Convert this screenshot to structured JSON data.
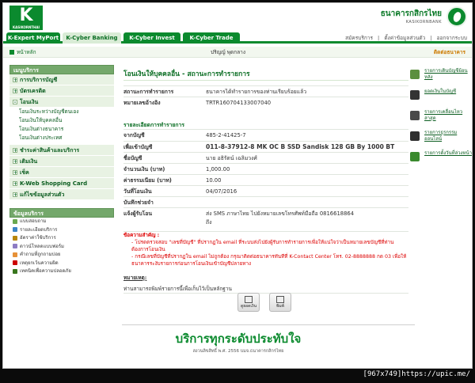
{
  "header": {
    "logo_text": "K",
    "logo_sub": "KASIKORNTHAI",
    "bank_name_th": "ธนาคารกสิกรไทย",
    "bank_name_en": "KASIKORNBANK"
  },
  "tabs": [
    {
      "label": "K-Expert MyPort"
    },
    {
      "label": "K-Cyber Banking"
    },
    {
      "label": "K-Cyber Invest"
    },
    {
      "label": "K-Cyber Trade"
    }
  ],
  "toplinks": {
    "apply": "สมัครบริการ",
    "settings": "ตั้งค่าข้อมูลส่วนตัว",
    "logout": "ออกจากระบบ"
  },
  "subbar": {
    "home": "หน้าหลัก",
    "user_name": "ปริญญ์ พุดกลาง",
    "contact": "ติดต่อธนาคาร"
  },
  "sidebar": {
    "head": "เมนูบริการ",
    "items": [
      {
        "label": "การบริการบัญชี",
        "sign": "+"
      },
      {
        "label": "บัตรเครดิต",
        "sign": "+"
      },
      {
        "label": "โอนเงิน",
        "sign": "-"
      }
    ],
    "subitems": [
      {
        "label": "โอนเงินระหว่างบัญชีตนเอง"
      },
      {
        "label": "โอนเงินให้บุคคลอื่น"
      },
      {
        "label": "โอนเงินต่างธนาคาร"
      },
      {
        "label": "โอนเงินต่างประเทศ"
      }
    ],
    "items2": [
      {
        "label": "ชำระค่าสินค้าและบริการ",
        "sign": "+"
      },
      {
        "label": "เติมเงิน",
        "sign": "+"
      },
      {
        "label": "เช็ค",
        "sign": "+"
      },
      {
        "label": "K-Web Shopping Card",
        "sign": "+"
      },
      {
        "label": "แก้ไขข้อมูลส่วนตัว",
        "sign": "+"
      }
    ],
    "head2": "ข้อมูลบริการ",
    "list": [
      {
        "label": "แบบสอบถาม",
        "color": "#6aa84f"
      },
      {
        "label": "รายละเอียดบริการ",
        "color": "#3d85c6"
      },
      {
        "label": "อัตราค่าใช้บริการ",
        "color": "#b8860b"
      },
      {
        "label": "ดาวน์โหลดแบบฟอร์ม",
        "color": "#8e7cc3"
      },
      {
        "label": "คำถามที่ถูกถามบ่อย",
        "color": "#e69138"
      },
      {
        "label": "เหตุยกเว้นความผิด",
        "color": "#cc0000"
      },
      {
        "label": "เทคนิคเพื่อความปลอดภัย",
        "color": "#38761d"
      }
    ]
  },
  "main": {
    "title": "โอนเงินให้บุคคลอื่น - สถานะการทำรายการ",
    "status_label": "สถานะการทำรายการ",
    "status_value": "ธนาคารได้ทำรายการของท่านเรียบร้อยแล้ว",
    "ref_label": "หมายเลขอ้างอิง",
    "ref_value": "TRTR160704133007040",
    "details_label": "รายละเอียดการทำรายการ",
    "from_label": "จากบัญชี",
    "from_value": "485-2-41425-7",
    "to_label": "เพื่อเข้าบัญชี",
    "to_value": "011-8-37912-8 MK OC B SSD Sandisk 128 GB By 1000 BT",
    "name_label": "ชื่อบัญชี",
    "name_value": "นาย อธิรัตน์ เฉลิมวงศ์",
    "amount_label": "จำนวนเงิน (บาท)",
    "amount_value": "1,000.00",
    "fee_label": "ค่าธรรมเนียม (บาท)",
    "fee_value": "10.00",
    "date_label": "วันที่โอนเงิน",
    "date_value": "04/07/2016",
    "memo_label": "บันทึกช่วยจำ",
    "memo_value": "",
    "notify_label": "แจ้งผู้รับโอน",
    "notify_value": "ส่ง SMS ภาษาไทย ไปยังหมายเลขโทรศัพท์มือถือ 0816618864",
    "notify_value2": "ถึง",
    "notice_head": "ข้อความสำคัญ :",
    "notice_1": "- โปรดตรวจสอบ \"เลขที่บัญชี\" ที่ปรากฏใน email ที่ระบบส่งไปยังผู้รับการทำรายการเพื่อให้แน่ใจว่าเป็นหมายเลขบัญชีที่ท่านต้องการโอนเงิน",
    "notice_2": "- กรณีเลขที่บัญชีที่ปรากฏใน email ไม่ถูกต้อง กรุณาติดต่อธนาคารทันทีที่ K-Contact Center โทร. 02-8888888 กด 03 เพื่อให้ธนาคารระงับรายการก่อนการโอนเงินเข้าบัญชีปลายทาง",
    "remark_label": "หมายเหตุ:",
    "remark_value": "ท่านสามารถพิมพ์รายการนี้เพื่อเก็บไว้เป็นหลักฐาน",
    "btn_view": "ดูยอดเงิน",
    "btn_print": "พิมพ์"
  },
  "rail": [
    {
      "label": "รายการเดินบัญชีย้อนหลัง",
      "color": "#5b8f3e"
    },
    {
      "label": "ยอดเงินในบัญชี",
      "color": "#333333"
    },
    {
      "label": "รายการเคลื่อนไหวล่าสุด",
      "color": "#4a4a4a"
    },
    {
      "label": "รายการธุรกรรมออนไลน์",
      "color": "#2f2f2f"
    },
    {
      "label": "รายการตั้งวันที่ล่วงหน้า",
      "color": "#3a8a2e"
    }
  ],
  "footer": {
    "slogan": "บริการทุกระดับประทับใจ",
    "copyright": "สงวนลิขสิทธิ์ พ.ศ. 2556 บมจ.ธนาคารกสิกรไทย",
    "credit": "[967x749]https://upic.me/"
  }
}
